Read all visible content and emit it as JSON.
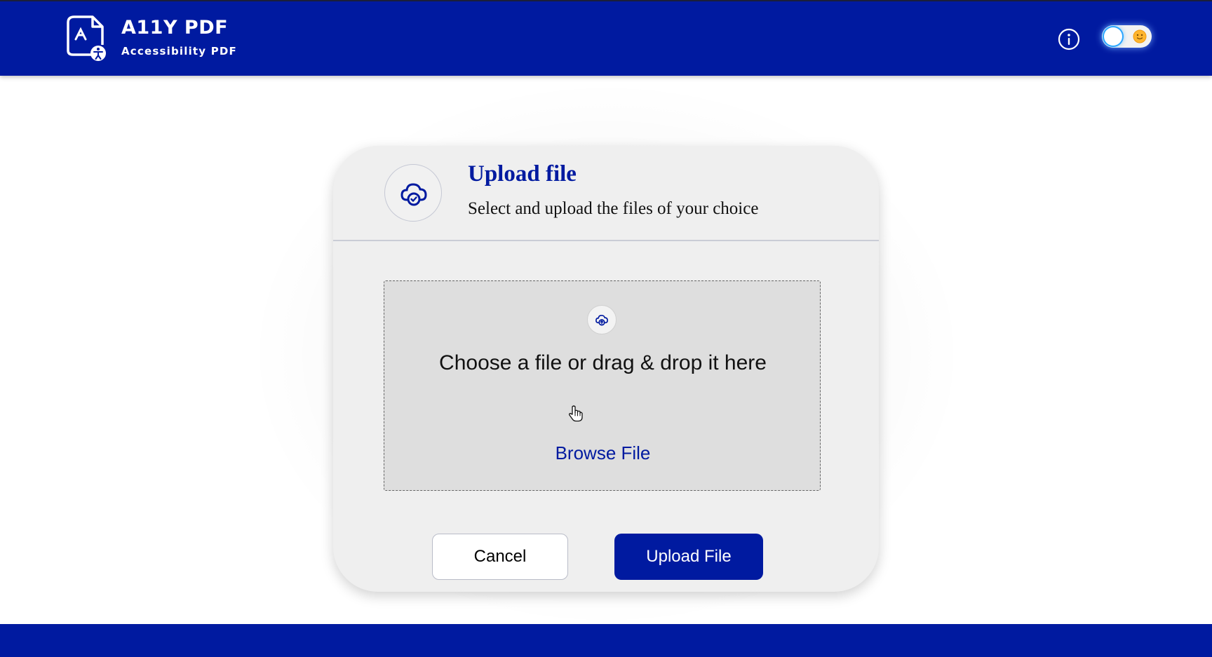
{
  "brand": {
    "title": "A11Y PDF",
    "subtitle": "Accessibility PDF",
    "logo_icon": "pdf-accessibility-icon"
  },
  "header_actions": {
    "info_icon": "info-icon",
    "theme_toggle": {
      "state": "light",
      "icon": "sun-icon"
    }
  },
  "upload_card": {
    "title": "Upload file",
    "subtitle": "Select and upload the files of your choice",
    "header_icon": "cloud-check-icon"
  },
  "dropzone": {
    "icon": "cloud-upload-icon",
    "prompt": "Choose a file or drag & drop it here",
    "browse_label": "Browse File"
  },
  "actions": {
    "cancel_label": "Cancel",
    "upload_label": "Upload File"
  },
  "colors": {
    "primary": "#001aa0",
    "card_bg": "#efefef",
    "dropzone_bg": "#dedede"
  }
}
